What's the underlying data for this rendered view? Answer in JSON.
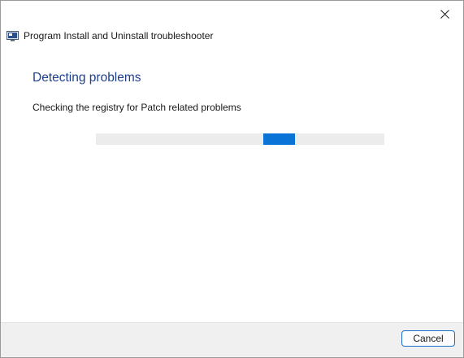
{
  "window": {
    "title": "Program Install and Uninstall troubleshooter",
    "close_icon": "close-icon",
    "app_icon": "troubleshooter-icon"
  },
  "main": {
    "heading": "Detecting problems",
    "status": "Checking the registry for Patch related problems"
  },
  "progress": {
    "mode": "indeterminate",
    "chunk_start_fraction": 0.58,
    "chunk_width_fraction": 0.11
  },
  "footer": {
    "cancel_label": "Cancel"
  },
  "colors": {
    "heading": "#1e3f8f",
    "progress_fill": "#0a74d6",
    "progress_track": "#ececec",
    "footer_bg": "#f0f0f0",
    "button_border": "#1a6fc9"
  }
}
